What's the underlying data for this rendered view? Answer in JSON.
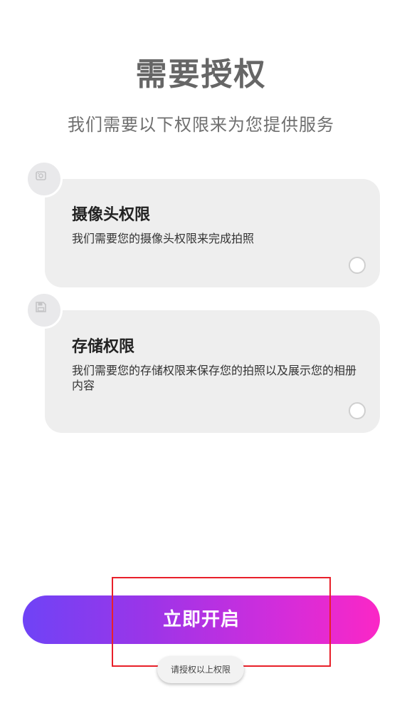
{
  "page": {
    "title": "需要授权",
    "subtitle": "我们需要以下权限来为您提供服务"
  },
  "permissions": [
    {
      "icon": "camera-icon",
      "title": "摄像头权限",
      "description": "我们需要您的摄像头权限来完成拍照",
      "checked": false
    },
    {
      "icon": "storage-icon",
      "title": "存储权限",
      "description": "我们需要您的存储权限来保存您的拍照以及展示您的相册内容",
      "checked": false
    }
  ],
  "action": {
    "button_label": "立即开启"
  },
  "toast": {
    "message": "请授权以上权限"
  },
  "colors": {
    "gradient_start": "#6f43f6",
    "gradient_end": "#fb27c6",
    "highlight_border": "#e8202a",
    "card_background": "#eeeeee"
  }
}
